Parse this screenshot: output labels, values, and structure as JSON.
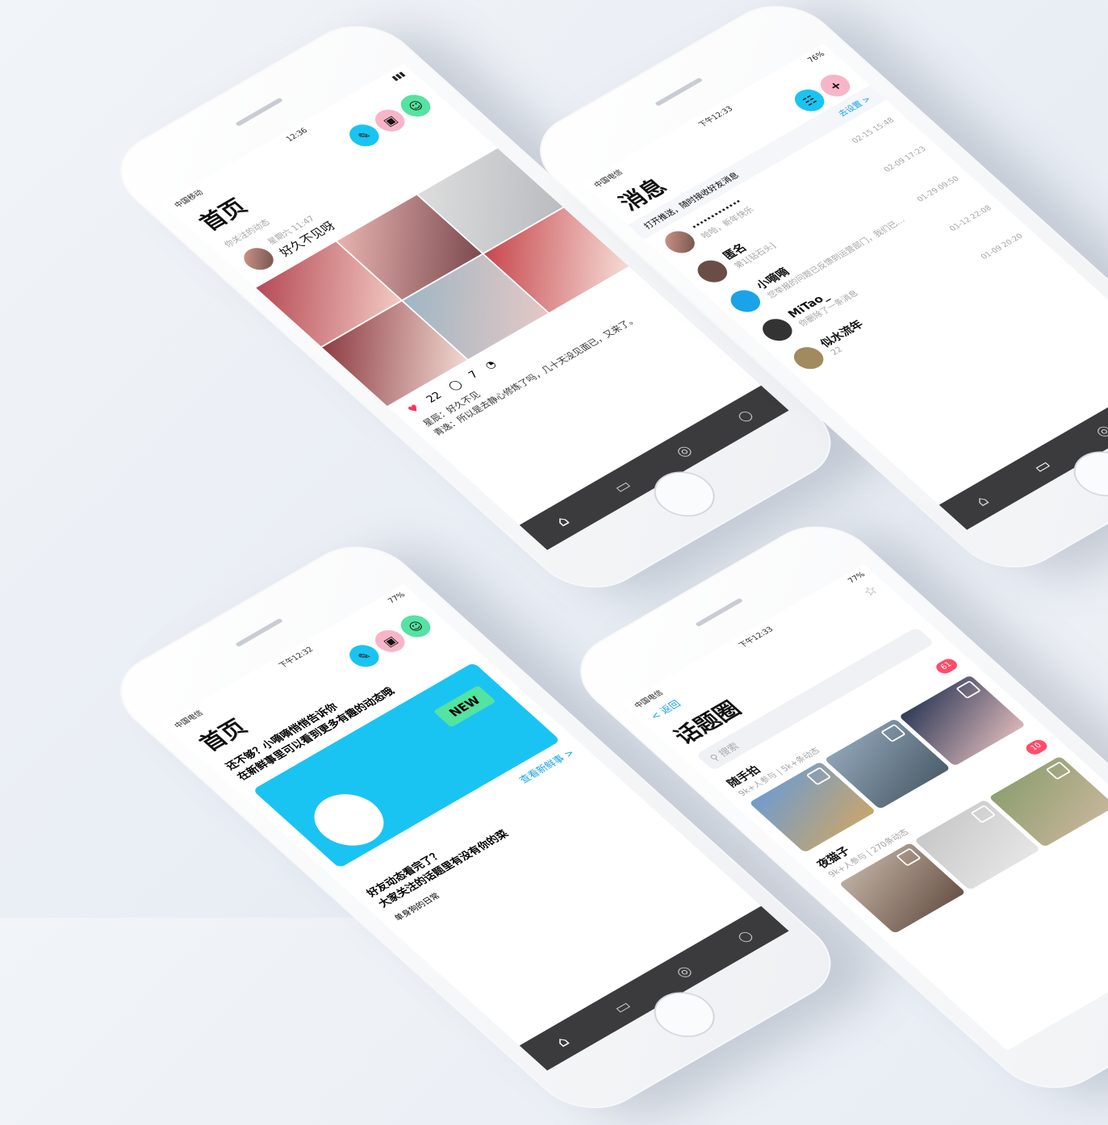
{
  "home": {
    "carrier": "中国移动",
    "time": "12:36",
    "title": "首页",
    "subtitle": "你关注的动态",
    "post_time": "星期六 11:47",
    "post_text": "好久不见呀",
    "likes": "22",
    "comments": "7",
    "comment1": "星辰：好久不见",
    "comment2": "青逸：所以是去静心修炼了吗，几十天没见面已，又来了。"
  },
  "messages": {
    "carrier": "中国电信",
    "time": "下午12:33",
    "battery": "76%",
    "title": "消息",
    "notice": "打开推送，随时接收好友消息",
    "notice_action": "去设置 >",
    "items": [
      {
        "name": "·············",
        "preview": "哈哈，新年快乐",
        "time": "02-15 15:48"
      },
      {
        "name": "匿名",
        "preview": "第1[钻石头]",
        "time": "02-09 17:23"
      },
      {
        "name": "小嘀嘀",
        "preview": "您举报的问题已反馈到运营部门，我们已…",
        "time": "01-29 09:50"
      },
      {
        "name": "MiTao_",
        "preview": "你删除了一条消息",
        "time": "01-12 22:08"
      },
      {
        "name": "似水流年",
        "preview": "22",
        "time": "01-09 20:20"
      }
    ]
  },
  "home2": {
    "carrier": "中国电信",
    "time": "下午12:32",
    "battery": "77%",
    "title": "首页",
    "banner_line1": "还不够？小嘀嘀悄悄告诉你",
    "banner_line2": "在新鲜事里可以看到更多有趣的动态哦",
    "new_label": "NEW",
    "link": "查看新鲜事 >",
    "section1": "好友动态看完了？",
    "section2": "大家关注的话题里有没有你的菜",
    "card_label": "单身狗的日常"
  },
  "topics": {
    "carrier": "中国电信",
    "time": "下午12:33",
    "battery": "77%",
    "back": "< 返回",
    "title": "话题圈",
    "search_placeholder": "搜索",
    "topic1": {
      "name": "随手拍",
      "meta": "9k+人参与 | 5k+条动态",
      "badge": "61"
    },
    "topic2": {
      "name": "夜猫子",
      "meta": "9k+人参与 | 270条动态",
      "badge": "10"
    }
  },
  "colors": {
    "cyan": "#19c4f2",
    "pink": "#f7b6c8",
    "green": "#54e3a0",
    "tabbar": "#3b3b3d",
    "badge": "#ff4d6a"
  }
}
